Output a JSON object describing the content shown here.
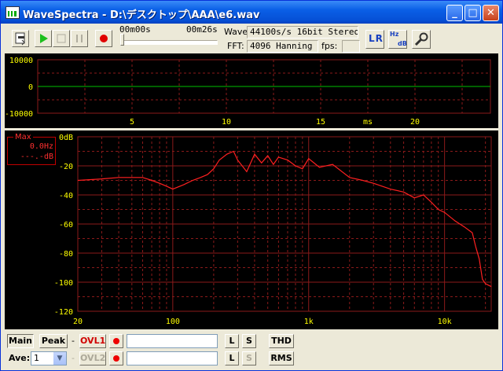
{
  "window": {
    "title": "WaveSpectra - D:\\デスクトップ\\AAA\\e6.wav"
  },
  "controls": {
    "min": "_",
    "max": "□",
    "close": "✕"
  },
  "toolbar": {
    "time_start": "00m00s",
    "time_end": "00m26s",
    "wave_label": "Wave:",
    "wave_value": "44100s/s 16bit Stereo",
    "fft_label": "FFT:",
    "fft_value": "4096 Hanning",
    "fps_label": "fps:",
    "fps_value": "",
    "lr_label": "LR",
    "hz_label": "Hz",
    "db_label": "dB",
    "seek_progress": 0.0
  },
  "colors": {
    "grid": "#8b1a1a",
    "axis_text": "#ffff00",
    "wave": "#00c000",
    "spectrum": "#ff2020",
    "accent": "#e00000"
  },
  "wave_view": {
    "y_ticks": [
      "10000",
      "0",
      "-10000"
    ],
    "x_ticks": [
      "5",
      "10",
      "15",
      "20"
    ],
    "x_unit": "ms"
  },
  "spectrum_view": {
    "max_label": "Max",
    "max_freq": "0.0Hz",
    "max_db": "---.-dB",
    "y_ticks": [
      "0dB",
      "-20",
      "-40",
      "-60",
      "-80",
      "-100",
      "-120"
    ],
    "x_ticks": [
      "20",
      "100",
      "1k",
      "10k"
    ]
  },
  "chart_data": [
    {
      "type": "line",
      "title": "",
      "xlabel": "ms",
      "ylabel": "",
      "x": [
        0,
        24
      ],
      "values": [
        0,
        0
      ],
      "xlim": [
        0,
        24
      ],
      "ylim": [
        -10000,
        10000
      ],
      "grid": true
    },
    {
      "type": "line",
      "title": "",
      "xlabel": "",
      "ylabel": "",
      "x_scale": "log",
      "xlim": [
        20,
        22050
      ],
      "ylim": [
        -120,
        0
      ],
      "grid": true,
      "x": [
        20,
        30,
        40,
        50,
        60,
        65,
        70,
        80,
        90,
        100,
        120,
        140,
        160,
        180,
        200,
        220,
        250,
        280,
        300,
        350,
        400,
        450,
        500,
        550,
        600,
        700,
        800,
        900,
        1000,
        1200,
        1500,
        2000,
        2500,
        3000,
        4000,
        5000,
        6000,
        7000,
        8000,
        9000,
        10000,
        12000,
        14000,
        16000,
        17000,
        18000,
        19000,
        20000,
        22050
      ],
      "values": [
        -30,
        -29,
        -28,
        -28,
        -28,
        -29,
        -30,
        -32,
        -34,
        -36,
        -33,
        -30,
        -28,
        -26,
        -22,
        -16,
        -12,
        -10,
        -16,
        -24,
        -12,
        -18,
        -13,
        -19,
        -14,
        -16,
        -20,
        -22,
        -15,
        -21,
        -19,
        -28,
        -30,
        -32,
        -36,
        -38,
        -42,
        -40,
        -45,
        -50,
        -52,
        -58,
        -62,
        -66,
        -76,
        -84,
        -98,
        -101,
        -103
      ]
    }
  ],
  "bottom": {
    "main_label": "Main",
    "peak_label": "Peak",
    "ovl1": "OVL1",
    "ovl2": "OVL2",
    "ave_label": "Ave:",
    "ave_value": "1",
    "l_label": "L",
    "s_label": "S",
    "thd_label": "THD",
    "rms_label": "RMS",
    "dash": "-"
  }
}
